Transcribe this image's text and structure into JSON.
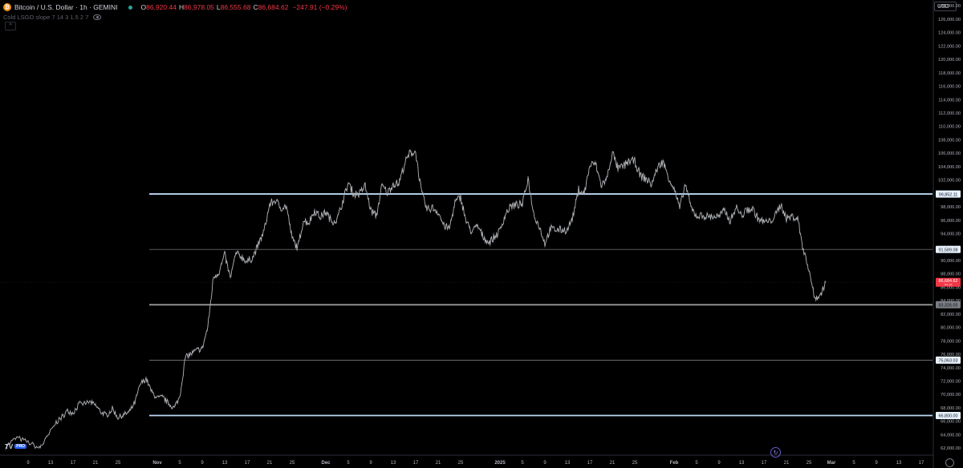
{
  "header": {
    "symbol": "Bitcoin / U.S. Dollar · 1h · GEMINI",
    "o_label": "O",
    "o_value": "86,920.44",
    "h_label": "H",
    "h_value": "86,978.05",
    "l_label": "L",
    "l_value": "86,555.68",
    "c_label": "C",
    "c_value": "86,684.62",
    "change": "−247.91 (−0.29%)",
    "indicator": "Cold LSGO slope 7 14 3 1.5 2 7",
    "collapse_icon": "^",
    "btc_icon": "₿"
  },
  "currency": "USD",
  "logo": {
    "text": "TV",
    "badge": "PRO"
  },
  "colors": {
    "background": "#000000",
    "candle": "#b0b3b8",
    "last_price": "#f23645",
    "level_highlight": "#bcd9f5",
    "level_gray": "#9a9a9a",
    "axis_text": "#b2b5be"
  },
  "chart_data": {
    "type": "line",
    "title": "",
    "xlabel": "",
    "ylabel": "",
    "ylim": [
      61000,
      128800
    ],
    "grid": false,
    "y_ticks": [
      "62,000.00",
      "64,000.00",
      "66,000.00",
      "68,000.00",
      "70,000.00",
      "72,000.00",
      "74,000.00",
      "76,000.00",
      "78,000.00",
      "80,000.00",
      "82,000.00",
      "84,000.00",
      "86,000.00",
      "88,000.00",
      "90,000.00",
      "92,000.00",
      "94,000.00",
      "96,000.00",
      "98,000.00",
      "100,000.00",
      "102,000.00",
      "104,000.00",
      "106,000.00",
      "108,000.00",
      "110,000.00",
      "112,000.00",
      "114,000.00",
      "116,000.00",
      "118,000.00",
      "120,000.00",
      "122,000.00",
      "124,000.00",
      "126,000.00",
      "128,000.00"
    ],
    "x_ticks": [
      {
        "label": "9",
        "date": "2024-10-09"
      },
      {
        "label": "13",
        "date": "2024-10-13"
      },
      {
        "label": "17",
        "date": "2024-10-17"
      },
      {
        "label": "21",
        "date": "2024-10-21"
      },
      {
        "label": "25",
        "date": "2024-10-25"
      },
      {
        "label": "Nov",
        "date": "2024-11-01"
      },
      {
        "label": "5",
        "date": "2024-11-05"
      },
      {
        "label": "9",
        "date": "2024-11-09"
      },
      {
        "label": "13",
        "date": "2024-11-13"
      },
      {
        "label": "17",
        "date": "2024-11-17"
      },
      {
        "label": "21",
        "date": "2024-11-21"
      },
      {
        "label": "25",
        "date": "2024-11-25"
      },
      {
        "label": "Dec",
        "date": "2024-12-01"
      },
      {
        "label": "5",
        "date": "2024-12-05"
      },
      {
        "label": "9",
        "date": "2024-12-09"
      },
      {
        "label": "13",
        "date": "2024-12-13"
      },
      {
        "label": "17",
        "date": "2024-12-17"
      },
      {
        "label": "21",
        "date": "2024-12-21"
      },
      {
        "label": "25",
        "date": "2024-12-25"
      },
      {
        "label": "2025",
        "date": "2025-01-01"
      },
      {
        "label": "5",
        "date": "2025-01-05"
      },
      {
        "label": "9",
        "date": "2025-01-09"
      },
      {
        "label": "13",
        "date": "2025-01-13"
      },
      {
        "label": "17",
        "date": "2025-01-17"
      },
      {
        "label": "21",
        "date": "2025-01-21"
      },
      {
        "label": "25",
        "date": "2025-01-25"
      },
      {
        "label": "Feb",
        "date": "2025-02-01"
      },
      {
        "label": "5",
        "date": "2025-02-05"
      },
      {
        "label": "9",
        "date": "2025-02-09"
      },
      {
        "label": "13",
        "date": "2025-02-13"
      },
      {
        "label": "17",
        "date": "2025-02-17"
      },
      {
        "label": "21",
        "date": "2025-02-21"
      },
      {
        "label": "25",
        "date": "2025-02-25"
      },
      {
        "label": "Mar",
        "date": "2025-03-01"
      },
      {
        "label": "5",
        "date": "2025-03-05"
      },
      {
        "label": "9",
        "date": "2025-03-09"
      },
      {
        "label": "13",
        "date": "2025-03-13"
      },
      {
        "label": "17",
        "date": "2025-03-17"
      }
    ],
    "horizontal_levels": [
      {
        "value": 99852.11,
        "label": "99,852.11",
        "style": "highlight"
      },
      {
        "value": 91589.08,
        "label": "91,589.08",
        "style": "thin"
      },
      {
        "value": 83326.05,
        "label": "83,326.05",
        "style": "gray"
      },
      {
        "value": 75063.03,
        "label": "75,063.03",
        "style": "thin"
      },
      {
        "value": 66800.0,
        "label": "66,800.00",
        "style": "highlight"
      }
    ],
    "last_price": {
      "value": 86684.62,
      "label": "86,684.62",
      "countdown": "44:15"
    },
    "series": [
      {
        "points": [
          [
            "2024-10-05",
            62200
          ],
          [
            "2024-10-07",
            63500
          ],
          [
            "2024-10-09",
            62800
          ],
          [
            "2024-10-11",
            61900
          ],
          [
            "2024-10-12",
            63000
          ],
          [
            "2024-10-14",
            65800
          ],
          [
            "2024-10-15",
            66500
          ],
          [
            "2024-10-16",
            67500
          ],
          [
            "2024-10-17",
            67200
          ],
          [
            "2024-10-18",
            68400
          ],
          [
            "2024-10-20",
            68800
          ],
          [
            "2024-10-21",
            68300
          ],
          [
            "2024-10-22",
            67300
          ],
          [
            "2024-10-23",
            66800
          ],
          [
            "2024-10-24",
            67800
          ],
          [
            "2024-10-25",
            66500
          ],
          [
            "2024-10-26",
            66900
          ],
          [
            "2024-10-27",
            67300
          ],
          [
            "2024-10-28",
            68700
          ],
          [
            "2024-10-29",
            71500
          ],
          [
            "2024-10-30",
            72300
          ],
          [
            "2024-10-31",
            70300
          ],
          [
            "2024-11-01",
            69400
          ],
          [
            "2024-11-02",
            69500
          ],
          [
            "2024-11-03",
            68600
          ],
          [
            "2024-11-04",
            67900
          ],
          [
            "2024-11-05",
            69600
          ],
          [
            "2024-11-06",
            75500
          ],
          [
            "2024-11-07",
            76000
          ],
          [
            "2024-11-08",
            76500
          ],
          [
            "2024-11-09",
            76800
          ],
          [
            "2024-11-10",
            80000
          ],
          [
            "2024-11-11",
            87500
          ],
          [
            "2024-11-12",
            88200
          ],
          [
            "2024-11-13",
            90800
          ],
          [
            "2024-11-14",
            87300
          ],
          [
            "2024-11-15",
            91000
          ],
          [
            "2024-11-16",
            90500
          ],
          [
            "2024-11-17",
            89700
          ],
          [
            "2024-11-18",
            90400
          ],
          [
            "2024-11-19",
            92300
          ],
          [
            "2024-11-20",
            94300
          ],
          [
            "2024-11-21",
            98300
          ],
          [
            "2024-11-22",
            98900
          ],
          [
            "2024-11-23",
            97800
          ],
          [
            "2024-11-24",
            98000
          ],
          [
            "2024-11-25",
            93200
          ],
          [
            "2024-11-26",
            91800
          ],
          [
            "2024-11-27",
            95900
          ],
          [
            "2024-11-28",
            95600
          ],
          [
            "2024-11-29",
            97400
          ],
          [
            "2024-11-30",
            96400
          ],
          [
            "2024-12-01",
            97200
          ],
          [
            "2024-12-02",
            95800
          ],
          [
            "2024-12-03",
            96000
          ],
          [
            "2024-12-04",
            98700
          ],
          [
            "2024-12-05",
            101500
          ],
          [
            "2024-12-06",
            99800
          ],
          [
            "2024-12-07",
            99900
          ],
          [
            "2024-12-08",
            101100
          ],
          [
            "2024-12-09",
            97400
          ],
          [
            "2024-12-10",
            96600
          ],
          [
            "2024-12-11",
            101100
          ],
          [
            "2024-12-12",
            100000
          ],
          [
            "2024-12-13",
            101400
          ],
          [
            "2024-12-14",
            101400
          ],
          [
            "2024-12-15",
            104300
          ],
          [
            "2024-12-16",
            106000
          ],
          [
            "2024-12-17",
            106100
          ],
          [
            "2024-12-18",
            100200
          ],
          [
            "2024-12-19",
            97500
          ],
          [
            "2024-12-20",
            97800
          ],
          [
            "2024-12-21",
            97200
          ],
          [
            "2024-12-22",
            95100
          ],
          [
            "2024-12-23",
            94700
          ],
          [
            "2024-12-24",
            98600
          ],
          [
            "2024-12-25",
            99400
          ],
          [
            "2024-12-26",
            95700
          ],
          [
            "2024-12-27",
            94200
          ],
          [
            "2024-12-28",
            95100
          ],
          [
            "2024-12-29",
            93500
          ],
          [
            "2024-12-30",
            92600
          ],
          [
            "2024-12-31",
            93400
          ],
          [
            "2025-01-01",
            94400
          ],
          [
            "2025-01-02",
            96900
          ],
          [
            "2025-01-03",
            98100
          ],
          [
            "2025-01-04",
            98200
          ],
          [
            "2025-01-05",
            98300
          ],
          [
            "2025-01-06",
            102200
          ],
          [
            "2025-01-07",
            96900
          ],
          [
            "2025-01-08",
            95000
          ],
          [
            "2025-01-09",
            92500
          ],
          [
            "2025-01-10",
            94700
          ],
          [
            "2025-01-11",
            94500
          ],
          [
            "2025-01-12",
            94500
          ],
          [
            "2025-01-13",
            94500
          ],
          [
            "2025-01-14",
            96500
          ],
          [
            "2025-01-15",
            100500
          ],
          [
            "2025-01-16",
            99900
          ],
          [
            "2025-01-17",
            104100
          ],
          [
            "2025-01-18",
            104400
          ],
          [
            "2025-01-19",
            101200
          ],
          [
            "2025-01-20",
            102000
          ],
          [
            "2025-01-21",
            106100
          ],
          [
            "2025-01-22",
            103600
          ],
          [
            "2025-01-23",
            104000
          ],
          [
            "2025-01-24",
            104800
          ],
          [
            "2025-01-25",
            104700
          ],
          [
            "2025-01-26",
            102600
          ],
          [
            "2025-01-27",
            102100
          ],
          [
            "2025-01-28",
            101300
          ],
          [
            "2025-01-29",
            103700
          ],
          [
            "2025-01-30",
            104700
          ],
          [
            "2025-01-31",
            102400
          ],
          [
            "2025-02-01",
            100600
          ],
          [
            "2025-02-02",
            97700
          ],
          [
            "2025-02-03",
            101400
          ],
          [
            "2025-02-04",
            97800
          ],
          [
            "2025-02-05",
            96600
          ],
          [
            "2025-02-06",
            96600
          ],
          [
            "2025-02-07",
            96500
          ],
          [
            "2025-02-08",
            96500
          ],
          [
            "2025-02-09",
            96500
          ],
          [
            "2025-02-10",
            97400
          ],
          [
            "2025-02-11",
            95800
          ],
          [
            "2025-02-12",
            97900
          ],
          [
            "2025-02-13",
            96600
          ],
          [
            "2025-02-14",
            97500
          ],
          [
            "2025-02-15",
            97600
          ],
          [
            "2025-02-16",
            96100
          ],
          [
            "2025-02-17",
            95700
          ],
          [
            "2025-02-18",
            95700
          ],
          [
            "2025-02-19",
            96600
          ],
          [
            "2025-02-20",
            98300
          ],
          [
            "2025-02-21",
            96200
          ],
          [
            "2025-02-22",
            96500
          ],
          [
            "2025-02-23",
            96200
          ],
          [
            "2025-02-24",
            91500
          ],
          [
            "2025-02-25",
            88700
          ],
          [
            "2025-02-26",
            84300
          ],
          [
            "2025-02-27",
            84700
          ],
          [
            "2025-02-28",
            86684.62
          ]
        ]
      }
    ]
  }
}
